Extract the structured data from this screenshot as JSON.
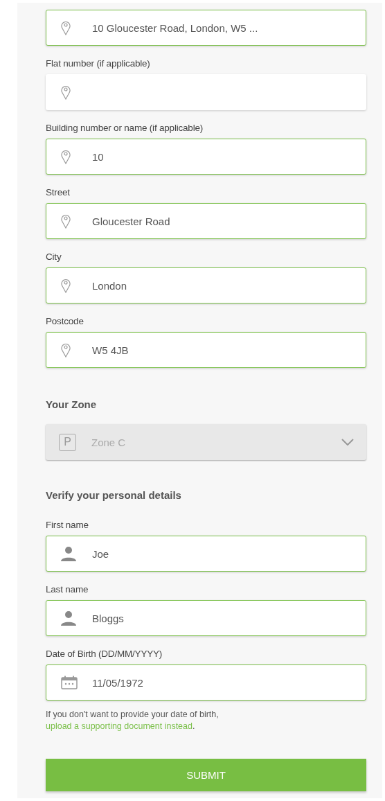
{
  "address_fields": [
    {
      "kind": "pin",
      "value": "10 Gloucester Road, London, W5 ...",
      "valid": true
    },
    {
      "label": "Flat number (if applicable)",
      "kind": "pin",
      "valid": false
    },
    {
      "label": "Building number or name (if applicable)",
      "kind": "pin",
      "value": "10",
      "valid": true
    },
    {
      "label": "Street",
      "kind": "pin",
      "value": "Gloucester Road",
      "valid": true
    },
    {
      "label": "City",
      "kind": "pin",
      "value": "London",
      "valid": true
    },
    {
      "label": "Postcode",
      "kind": "pin",
      "value": "W5 4JB",
      "valid": true
    }
  ],
  "zone": {
    "heading": "Your Zone",
    "icon_letter": "P",
    "value": "Zone C",
    "disabled": true
  },
  "personal": {
    "heading": "Verify your personal details",
    "fields": [
      {
        "label": "First name",
        "kind": "person",
        "value": "Joe",
        "valid": true
      },
      {
        "label": "Last name",
        "kind": "person",
        "value": "Bloggs",
        "valid": true
      },
      {
        "label": "Date of Birth (DD/MM/YYYY)",
        "kind": "date",
        "value": "11/05/1972",
        "valid": true
      }
    ]
  },
  "hint": {
    "text": "If you don't want to provide your date of birth,",
    "link": "upload a supporting document instead",
    "end": "."
  },
  "submit": "SUBMIT"
}
